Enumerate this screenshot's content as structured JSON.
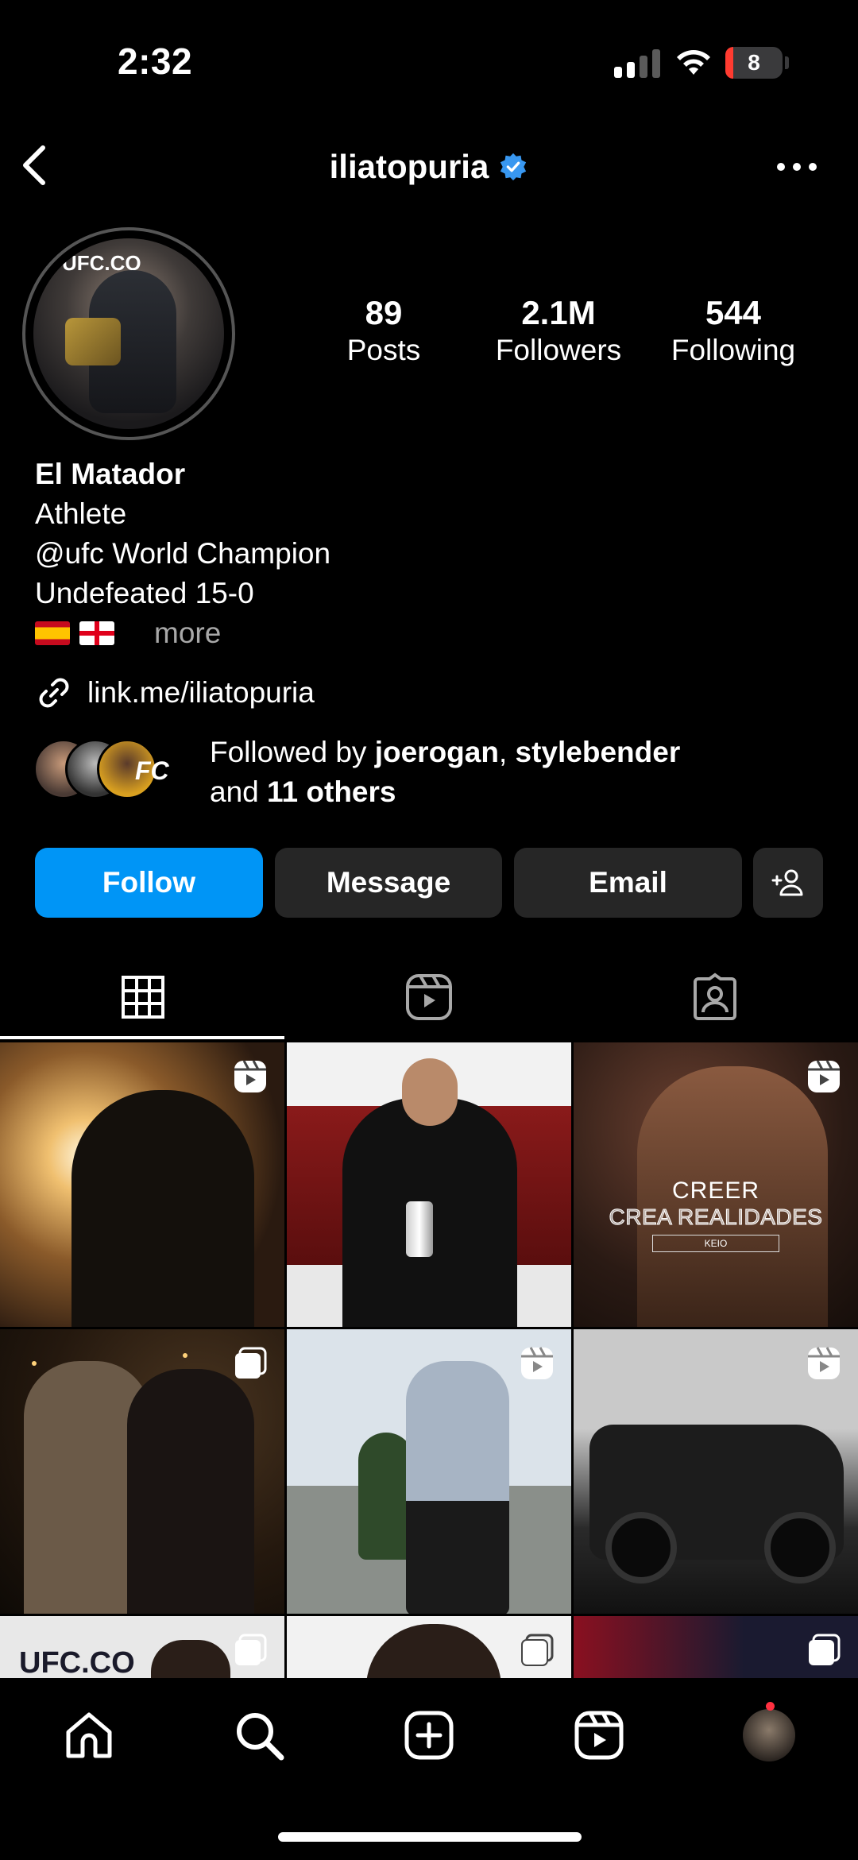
{
  "status_bar": {
    "time": "2:32",
    "battery": "8",
    "battery_color": "#ff3b30"
  },
  "header": {
    "username": "iliatopuria",
    "verified": true,
    "back_icon": "chevron-left-icon",
    "more_icon": "more-horizontal-icon"
  },
  "profile": {
    "avatar_text": "UFC.CO",
    "stats": [
      {
        "value": "89",
        "label": "Posts"
      },
      {
        "value": "2.1M",
        "label": "Followers"
      },
      {
        "value": "544",
        "label": "Following"
      }
    ],
    "name": "El Matador",
    "category": "Athlete",
    "bio_lines": [
      "@ufc World Champion",
      "Undefeated 15-0"
    ],
    "flags": [
      "spain-flag-icon",
      "georgia-flag-icon"
    ],
    "more_label": "more",
    "link": "link.me/iliatopuria",
    "followed_by": {
      "prefix": "Followed by",
      "user1": "joerogan",
      "separator": ",",
      "user2": "stylebender",
      "and_text": "and",
      "others": "11 others",
      "badge_text": "FC"
    }
  },
  "actions": {
    "follow": "Follow",
    "message": "Message",
    "email": "Email",
    "add_user_icon": "add-person-icon",
    "follow_color": "#0095f6"
  },
  "tabs": [
    {
      "icon": "grid-icon",
      "active": true
    },
    {
      "icon": "reels-icon",
      "active": false
    },
    {
      "icon": "tagged-icon",
      "active": false
    }
  ],
  "posts": {
    "creer_line1": "CREER",
    "creer_line2": "CREA REALIDADES",
    "creer_tag": "KEIO",
    "ufc_text": "UFC.CO",
    "badges": [
      "reel",
      "none",
      "reel",
      "carousel",
      "reel",
      "reel",
      "carousel",
      "carousel",
      "carousel"
    ]
  },
  "bottom_nav": [
    {
      "icon": "home-icon"
    },
    {
      "icon": "search-icon"
    },
    {
      "icon": "create-icon"
    },
    {
      "icon": "reels-icon"
    },
    {
      "icon": "profile-avatar"
    }
  ]
}
